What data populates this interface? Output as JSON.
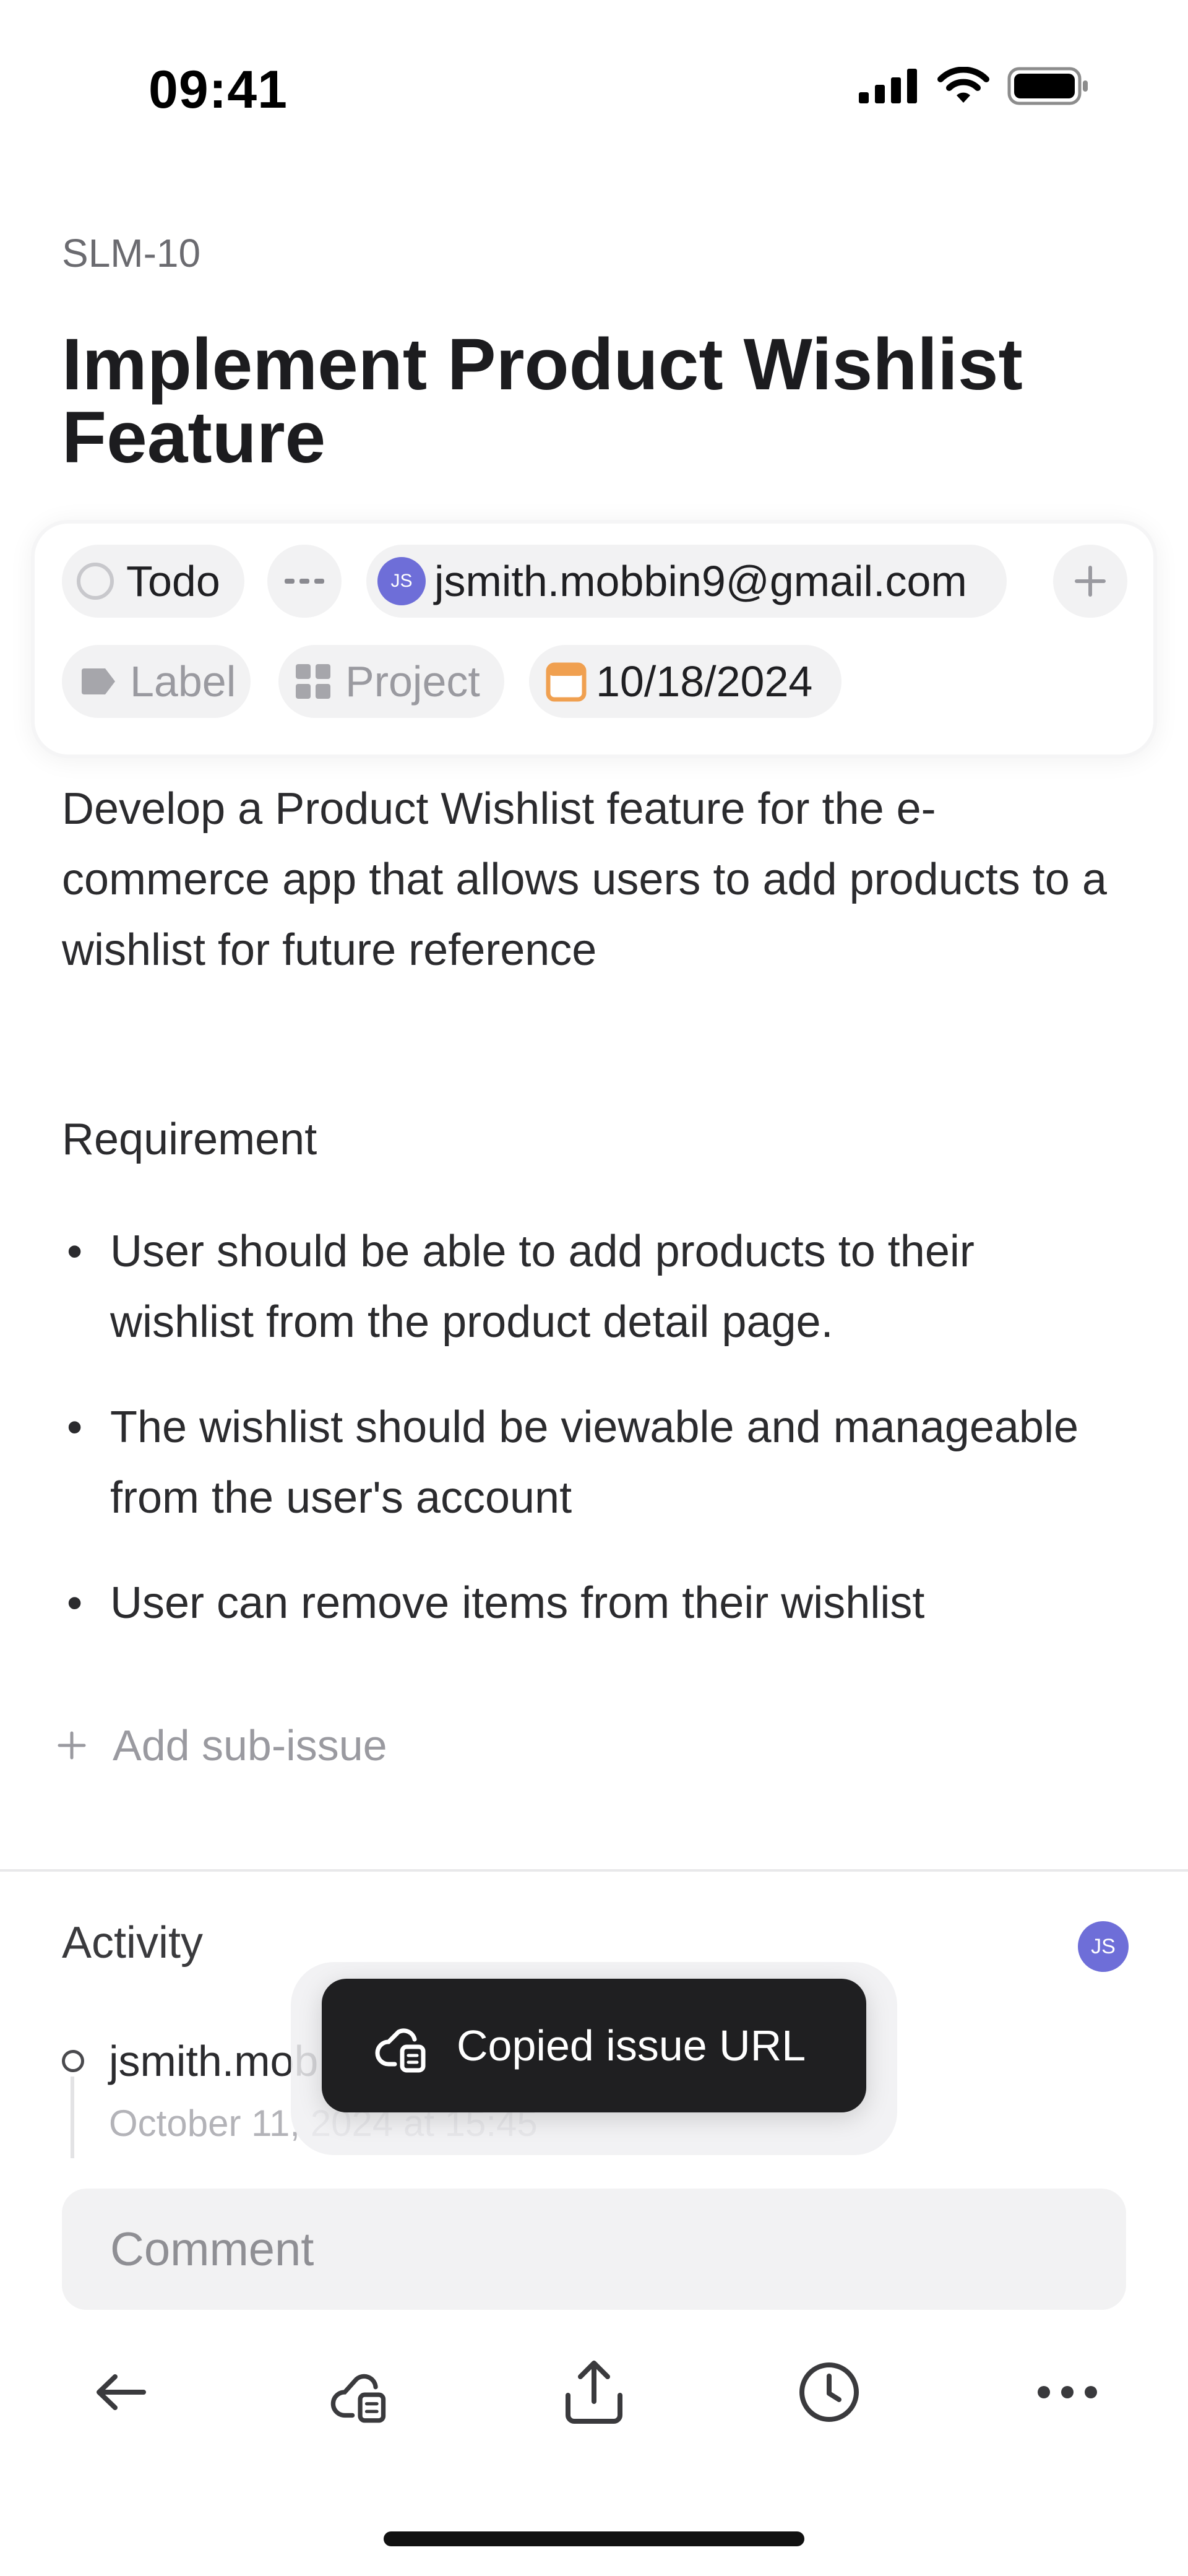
{
  "status_bar": {
    "time": "09:41",
    "icons": [
      "signal-icon",
      "wifi-icon",
      "battery-icon"
    ]
  },
  "issue": {
    "id": "SLM-10",
    "title": "Implement Product Wishlist Feature",
    "properties": {
      "status": "Todo",
      "priority_icon": "priority-dashes-icon",
      "assignee_initials": "JS",
      "assignee": "jsmith.mobbin9@gmail.com",
      "add_icon": "plus-icon",
      "label": "Label",
      "project": "Project",
      "due_date": "10/18/2024"
    },
    "description": "Develop a Product Wishlist feature for the e-commerce app that allows users to add products to a wishlist for future reference",
    "requirement_heading": "Requirement",
    "requirements": [
      "User should be able to add products to their wishlist from the product detail page.",
      "The wishlist should be viewable and manageable from the user's account",
      "User can remove items from their wishlist"
    ],
    "add_subissue": "Add sub-issue"
  },
  "activity": {
    "title": "Activity",
    "avatar_initials": "JS",
    "entry_user": "jsmith.mob",
    "entry_date": "October 11, 2024 at 15:45"
  },
  "toast": {
    "text": "Copied issue URL",
    "icon": "link-copy-icon"
  },
  "comment": {
    "placeholder": "Comment"
  },
  "toolbar": {
    "items": [
      "back-arrow-icon",
      "copy-link-icon",
      "share-icon",
      "clock-icon",
      "more-icon"
    ]
  },
  "colors": {
    "accent": "#6e6ed8",
    "due_date_icon": "#f0a050",
    "toast_bg": "#1f1f21"
  }
}
